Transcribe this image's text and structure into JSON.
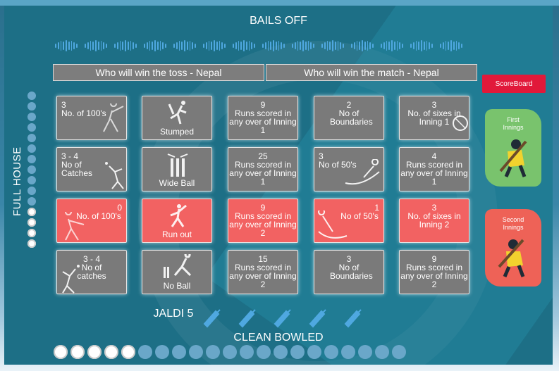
{
  "titles": {
    "bails_off": "BAILS OFF",
    "full_house": "FULL HOUSE",
    "clean_bowled": "CLEAN BOWLED",
    "jaldi": "JALDI 5"
  },
  "predictions": {
    "toss": "Who will win the toss - Nepal",
    "match": "Who will win the match - Nepal"
  },
  "sidebar": {
    "scoreboard": "ScoreBoard",
    "first_innings": "First Innings",
    "second_innings": "Second Innings"
  },
  "grid": {
    "r0": [
      {
        "num": "3",
        "label": "No. of 100's"
      },
      {
        "num": "",
        "label": "Stumped"
      },
      {
        "num": "9",
        "label": "Runs scored in any over of Inning 1"
      },
      {
        "num": "2",
        "label": "No of Boundaries"
      },
      {
        "num": "3",
        "label": "No. of sixes in Inning 1"
      }
    ],
    "r1": [
      {
        "num": "3 - 4",
        "label": "No of Catches"
      },
      {
        "num": "",
        "label": "Wide Ball"
      },
      {
        "num": "25",
        "label": "Runs scored in any over of Inning 1"
      },
      {
        "num": "3",
        "label": "No of 50's"
      },
      {
        "num": "4",
        "label": "Runs scored in any over of Inning 1"
      }
    ],
    "r2": [
      {
        "num": "0",
        "label": "No. of 100's"
      },
      {
        "num": "",
        "label": "Run out"
      },
      {
        "num": "9",
        "label": "Runs scored in any over of Inning 2"
      },
      {
        "num": "1",
        "label": "No of 50's"
      },
      {
        "num": "3",
        "label": "No. of sixes in Inning 2"
      }
    ],
    "r3": [
      {
        "num": "3 - 4",
        "label": "No of catches"
      },
      {
        "num": "",
        "label": "No Ball"
      },
      {
        "num": "15",
        "label": "Runs scored in any over of Inning 2"
      },
      {
        "num": "3",
        "label": "No of Boundaries"
      },
      {
        "num": "9",
        "label": "Runs scored in any over of Inning 2"
      }
    ]
  },
  "full_house_dots": {
    "total": 15,
    "filled": 4
  },
  "clean_bowled_dots": {
    "total": 21,
    "filled": 5
  },
  "colors": {
    "board": "#1d6f86",
    "cell_gray": "#7a7a7a",
    "cell_red": "#f26262",
    "scoreboard": "#e1193a",
    "first_innings": "#79c36d",
    "second_innings": "#ee6257",
    "accent_blue": "#4fa8e0"
  }
}
